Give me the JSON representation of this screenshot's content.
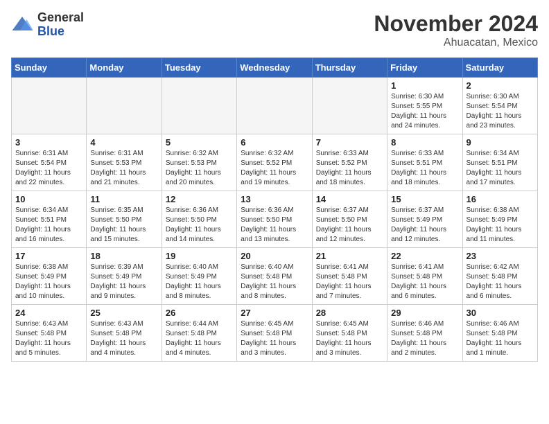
{
  "logo": {
    "general": "General",
    "blue": "Blue"
  },
  "title": "November 2024",
  "location": "Ahuacatan, Mexico",
  "days_of_week": [
    "Sunday",
    "Monday",
    "Tuesday",
    "Wednesday",
    "Thursday",
    "Friday",
    "Saturday"
  ],
  "weeks": [
    [
      {
        "day": "",
        "info": ""
      },
      {
        "day": "",
        "info": ""
      },
      {
        "day": "",
        "info": ""
      },
      {
        "day": "",
        "info": ""
      },
      {
        "day": "",
        "info": ""
      },
      {
        "day": "1",
        "info": "Sunrise: 6:30 AM\nSunset: 5:55 PM\nDaylight: 11 hours and 24 minutes."
      },
      {
        "day": "2",
        "info": "Sunrise: 6:30 AM\nSunset: 5:54 PM\nDaylight: 11 hours and 23 minutes."
      }
    ],
    [
      {
        "day": "3",
        "info": "Sunrise: 6:31 AM\nSunset: 5:54 PM\nDaylight: 11 hours and 22 minutes."
      },
      {
        "day": "4",
        "info": "Sunrise: 6:31 AM\nSunset: 5:53 PM\nDaylight: 11 hours and 21 minutes."
      },
      {
        "day": "5",
        "info": "Sunrise: 6:32 AM\nSunset: 5:53 PM\nDaylight: 11 hours and 20 minutes."
      },
      {
        "day": "6",
        "info": "Sunrise: 6:32 AM\nSunset: 5:52 PM\nDaylight: 11 hours and 19 minutes."
      },
      {
        "day": "7",
        "info": "Sunrise: 6:33 AM\nSunset: 5:52 PM\nDaylight: 11 hours and 18 minutes."
      },
      {
        "day": "8",
        "info": "Sunrise: 6:33 AM\nSunset: 5:51 PM\nDaylight: 11 hours and 18 minutes."
      },
      {
        "day": "9",
        "info": "Sunrise: 6:34 AM\nSunset: 5:51 PM\nDaylight: 11 hours and 17 minutes."
      }
    ],
    [
      {
        "day": "10",
        "info": "Sunrise: 6:34 AM\nSunset: 5:51 PM\nDaylight: 11 hours and 16 minutes."
      },
      {
        "day": "11",
        "info": "Sunrise: 6:35 AM\nSunset: 5:50 PM\nDaylight: 11 hours and 15 minutes."
      },
      {
        "day": "12",
        "info": "Sunrise: 6:36 AM\nSunset: 5:50 PM\nDaylight: 11 hours and 14 minutes."
      },
      {
        "day": "13",
        "info": "Sunrise: 6:36 AM\nSunset: 5:50 PM\nDaylight: 11 hours and 13 minutes."
      },
      {
        "day": "14",
        "info": "Sunrise: 6:37 AM\nSunset: 5:50 PM\nDaylight: 11 hours and 12 minutes."
      },
      {
        "day": "15",
        "info": "Sunrise: 6:37 AM\nSunset: 5:49 PM\nDaylight: 11 hours and 12 minutes."
      },
      {
        "day": "16",
        "info": "Sunrise: 6:38 AM\nSunset: 5:49 PM\nDaylight: 11 hours and 11 minutes."
      }
    ],
    [
      {
        "day": "17",
        "info": "Sunrise: 6:38 AM\nSunset: 5:49 PM\nDaylight: 11 hours and 10 minutes."
      },
      {
        "day": "18",
        "info": "Sunrise: 6:39 AM\nSunset: 5:49 PM\nDaylight: 11 hours and 9 minutes."
      },
      {
        "day": "19",
        "info": "Sunrise: 6:40 AM\nSunset: 5:49 PM\nDaylight: 11 hours and 8 minutes."
      },
      {
        "day": "20",
        "info": "Sunrise: 6:40 AM\nSunset: 5:48 PM\nDaylight: 11 hours and 8 minutes."
      },
      {
        "day": "21",
        "info": "Sunrise: 6:41 AM\nSunset: 5:48 PM\nDaylight: 11 hours and 7 minutes."
      },
      {
        "day": "22",
        "info": "Sunrise: 6:41 AM\nSunset: 5:48 PM\nDaylight: 11 hours and 6 minutes."
      },
      {
        "day": "23",
        "info": "Sunrise: 6:42 AM\nSunset: 5:48 PM\nDaylight: 11 hours and 6 minutes."
      }
    ],
    [
      {
        "day": "24",
        "info": "Sunrise: 6:43 AM\nSunset: 5:48 PM\nDaylight: 11 hours and 5 minutes."
      },
      {
        "day": "25",
        "info": "Sunrise: 6:43 AM\nSunset: 5:48 PM\nDaylight: 11 hours and 4 minutes."
      },
      {
        "day": "26",
        "info": "Sunrise: 6:44 AM\nSunset: 5:48 PM\nDaylight: 11 hours and 4 minutes."
      },
      {
        "day": "27",
        "info": "Sunrise: 6:45 AM\nSunset: 5:48 PM\nDaylight: 11 hours and 3 minutes."
      },
      {
        "day": "28",
        "info": "Sunrise: 6:45 AM\nSunset: 5:48 PM\nDaylight: 11 hours and 3 minutes."
      },
      {
        "day": "29",
        "info": "Sunrise: 6:46 AM\nSunset: 5:48 PM\nDaylight: 11 hours and 2 minutes."
      },
      {
        "day": "30",
        "info": "Sunrise: 6:46 AM\nSunset: 5:48 PM\nDaylight: 11 hours and 1 minute."
      }
    ]
  ]
}
